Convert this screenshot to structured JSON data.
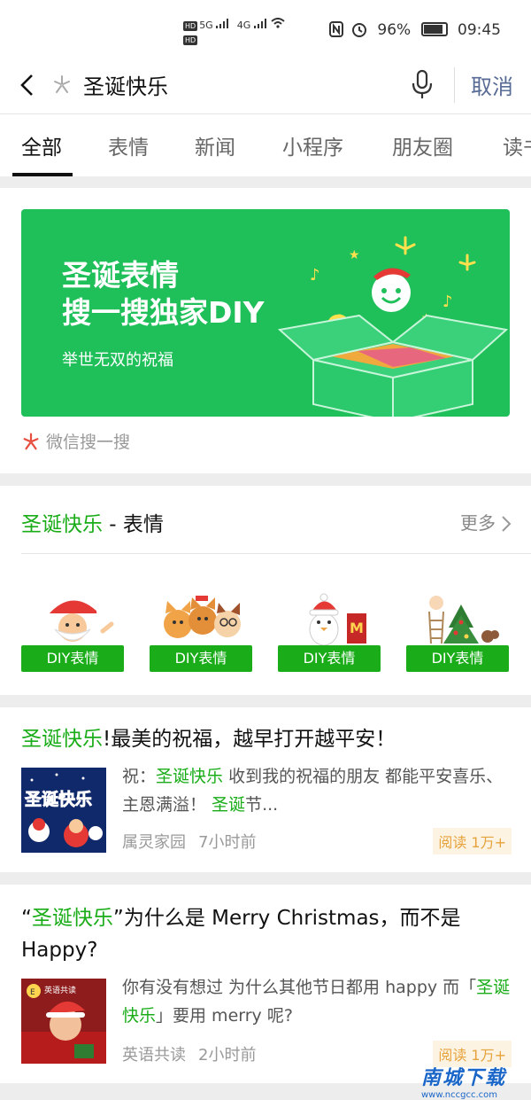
{
  "status_bar": {
    "hd1": "HD",
    "signal1": "5G",
    "hd2": "HD",
    "signal2": "4G",
    "nfc_icon": "nfc-icon",
    "alarm_icon": "alarm-icon",
    "battery": "96%",
    "time": "09:45"
  },
  "search": {
    "query": "圣诞快乐",
    "cancel_label": "取消"
  },
  "tabs": [
    {
      "label": "全部"
    },
    {
      "label": "表情"
    },
    {
      "label": "新闻"
    },
    {
      "label": "小程序"
    },
    {
      "label": "朋友圈"
    },
    {
      "label": "读书"
    }
  ],
  "banner": {
    "title_line1": "圣诞表情",
    "title_line2": "搜一搜独家DIY",
    "subtitle": "举世无双的祝福",
    "brand": "微信搜一搜",
    "accent_color": "#1fbf5a"
  },
  "stickers_section": {
    "title_highlight": "圣诞快乐",
    "title_rest": " - 表情",
    "more_label": "更多",
    "items": [
      {
        "button_label": "DIY表情",
        "icon": "santa-sticker-icon"
      },
      {
        "button_label": "DIY表情",
        "icon": "cats-sticker-icon"
      },
      {
        "button_label": "DIY表情",
        "icon": "penguin-sticker-icon"
      },
      {
        "button_label": "DIY表情",
        "icon": "tree-sticker-icon"
      }
    ]
  },
  "articles": [
    {
      "title_highlight": "圣诞快乐",
      "title_rest": "!最美的祝福，越早打开越平安！",
      "desc_prefix": "祝：",
      "desc_highlight1": "圣诞快乐",
      "desc_mid": " 收到我的祝福的朋友 都能平安喜乐、 主恩满溢！ ",
      "desc_highlight2": "圣诞",
      "desc_suffix": "节...",
      "thumb_text": "圣诞快乐",
      "source": "属灵家园",
      "time": "7小时前",
      "reads": "阅读 1万+"
    },
    {
      "title_prefix": "“",
      "title_highlight": "圣诞快乐",
      "title_rest": "”为什么是 Merry Christmas，而不是 Happy?",
      "desc_prefix": "你有没有想过 为什么其他节日都用 happy 而「",
      "desc_highlight": "圣诞快乐",
      "desc_suffix": "」要用 merry 呢?",
      "thumb_text": "英语共读",
      "source": "英语共读",
      "time": "2小时前",
      "reads": "阅读 1万+"
    }
  ],
  "watermark": {
    "main": "南城下载",
    "sub": "www.nccgcc.com"
  }
}
